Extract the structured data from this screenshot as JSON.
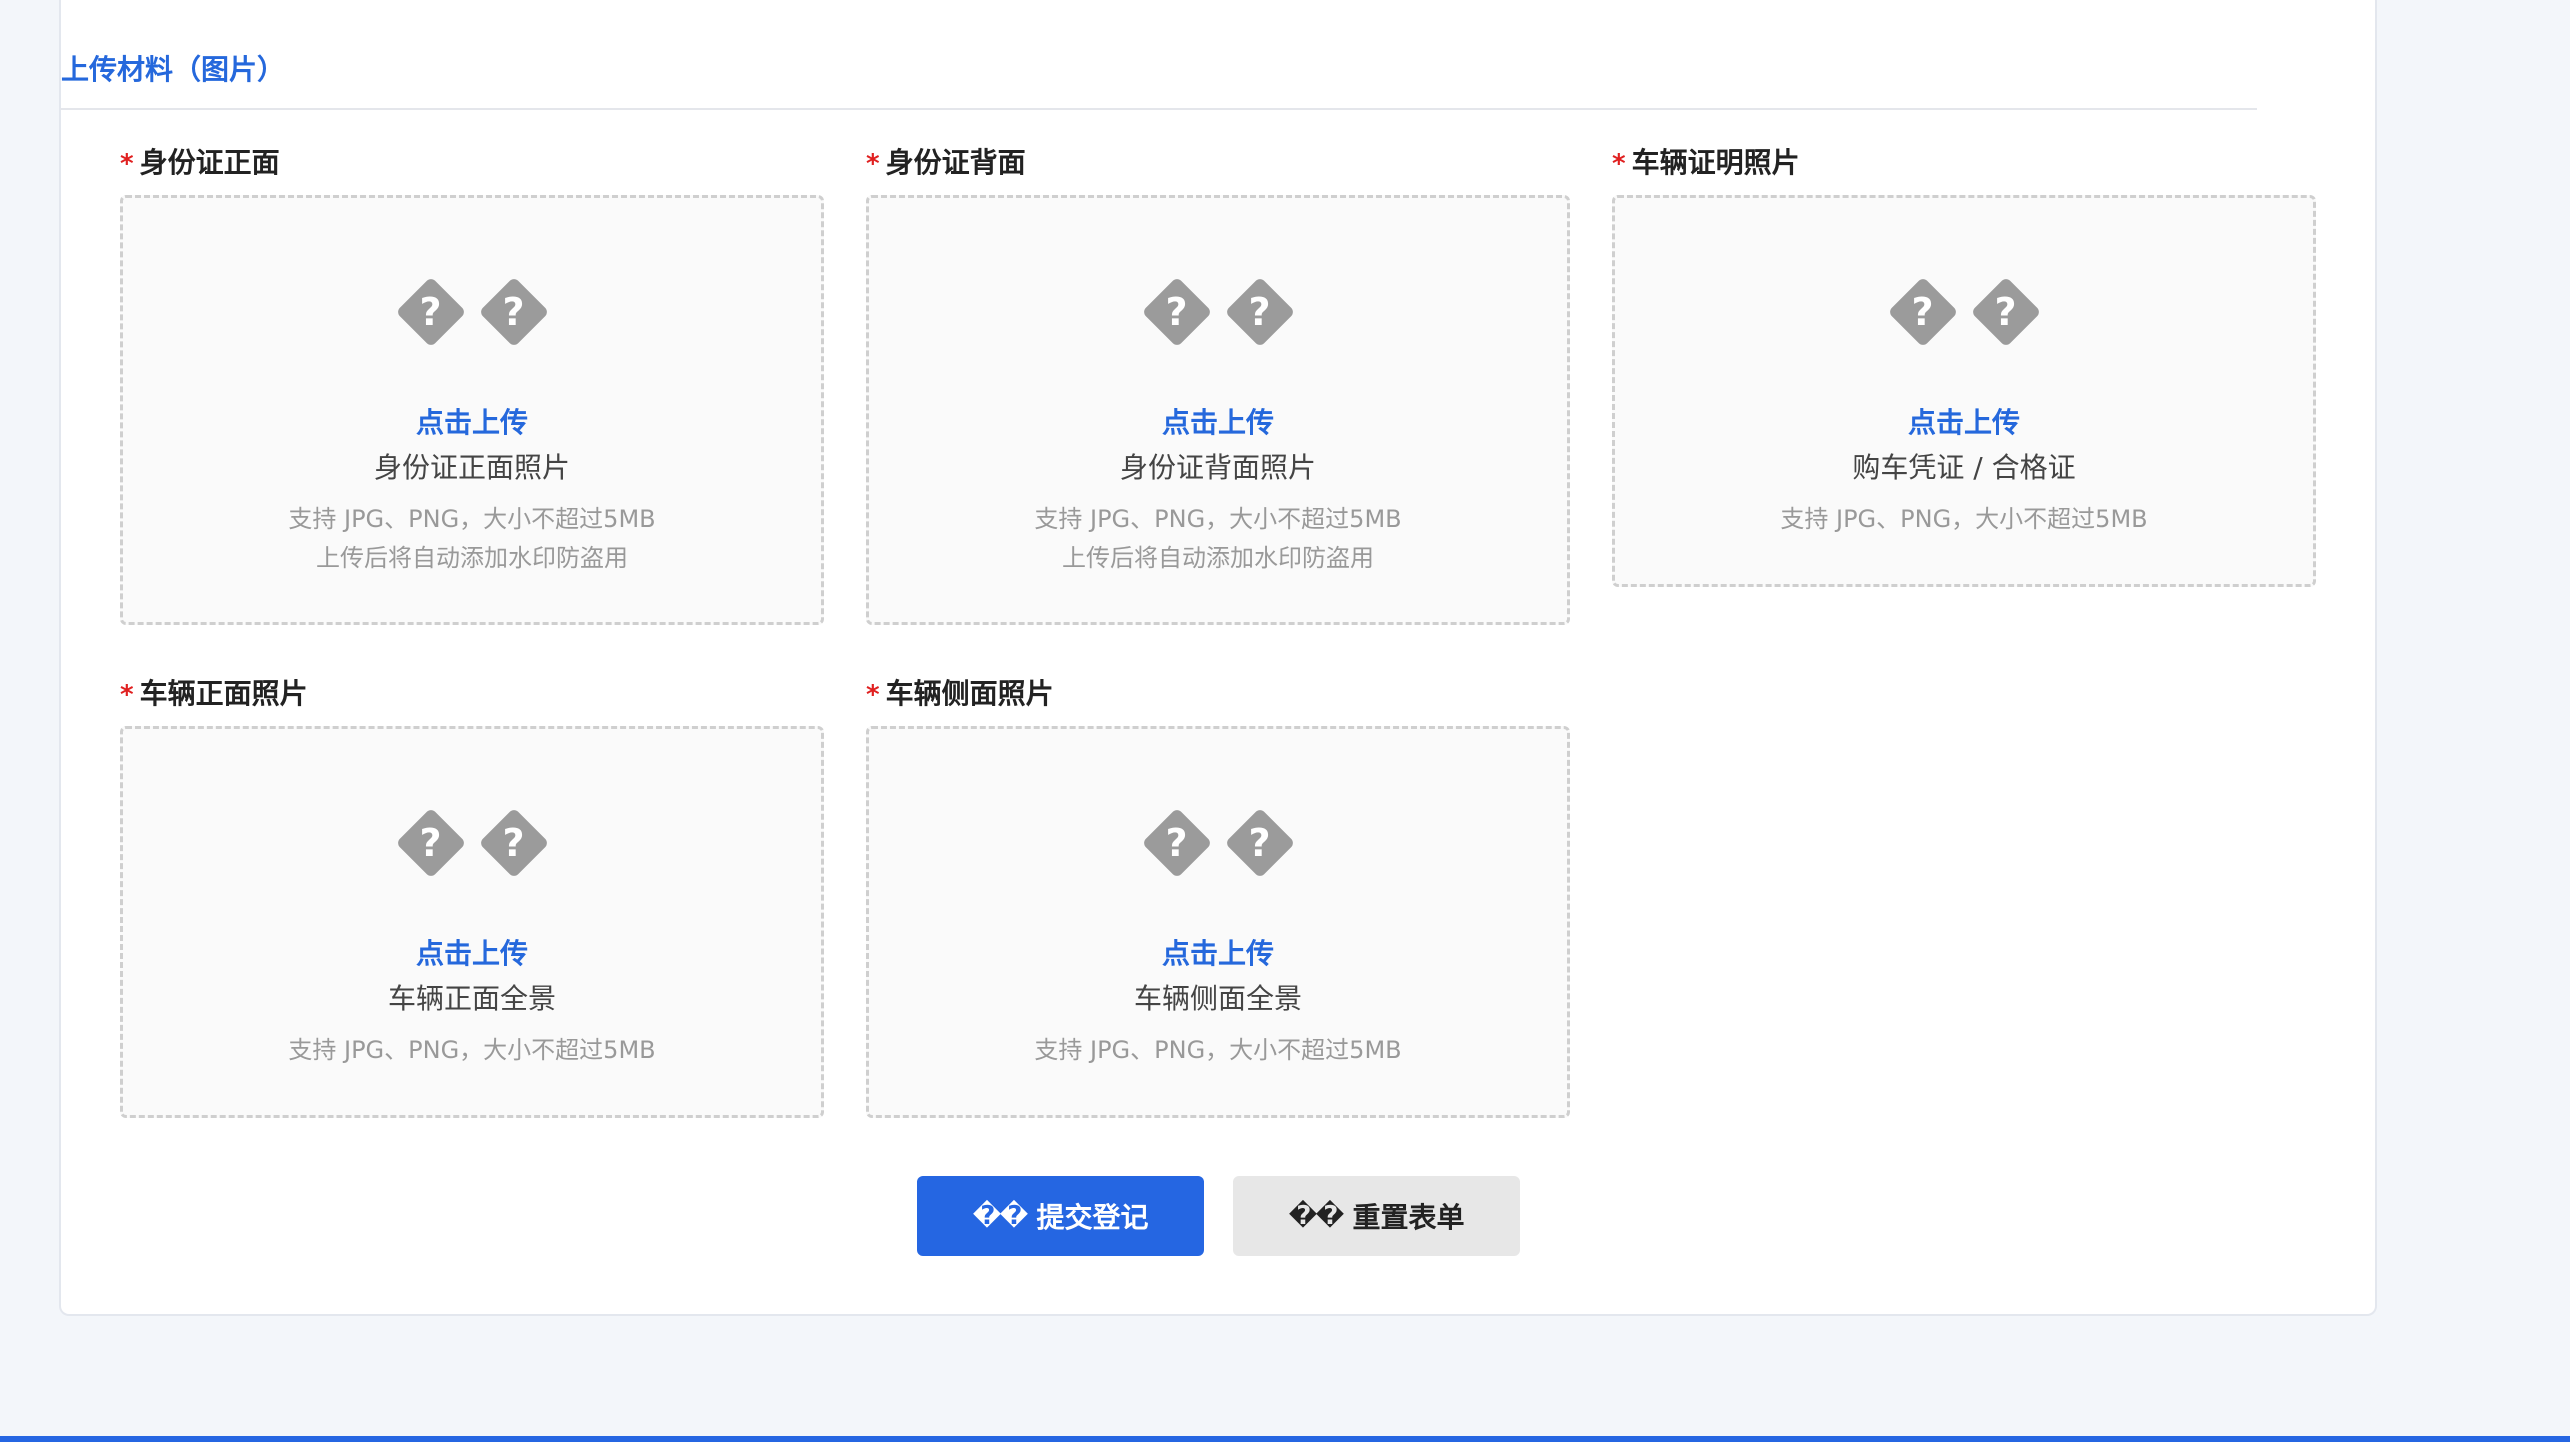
{
  "section": {
    "title": "上传材料（图片）"
  },
  "fields": [
    {
      "required": "*",
      "label": "身份证正面",
      "link": "点击上传",
      "desc": "身份证正面照片",
      "hint1": "支持 JPG、PNG，大小不超过5MB",
      "hint2": "上传后将自动添加水印防盗用"
    },
    {
      "required": "*",
      "label": "身份证背面",
      "link": "点击上传",
      "desc": "身份证背面照片",
      "hint1": "支持 JPG、PNG，大小不超过5MB",
      "hint2": "上传后将自动添加水印防盗用"
    },
    {
      "required": "*",
      "label": "车辆证明照片",
      "link": "点击上传",
      "desc": "购车凭证 / 合格证",
      "hint1": "支持 JPG、PNG，大小不超过5MB"
    },
    {
      "required": "*",
      "label": "车辆正面照片",
      "link": "点击上传",
      "desc": "车辆正面全景",
      "hint1": "支持 JPG、PNG，大小不超过5MB"
    },
    {
      "required": "*",
      "label": "车辆侧面照片",
      "link": "点击上传",
      "desc": "车辆侧面全景",
      "hint1": "支持 JPG、PNG，大小不超过5MB"
    }
  ],
  "icon_placeholder": "?",
  "icon_name": "unknown-glyph-icon",
  "buttons": {
    "submit_glyph": "��",
    "submit_label": "提交登记",
    "reset_glyph": "��",
    "reset_label": "重置表单"
  },
  "colors": {
    "accent": "#2566e2",
    "required": "#e02020",
    "link": "#2568dc"
  }
}
